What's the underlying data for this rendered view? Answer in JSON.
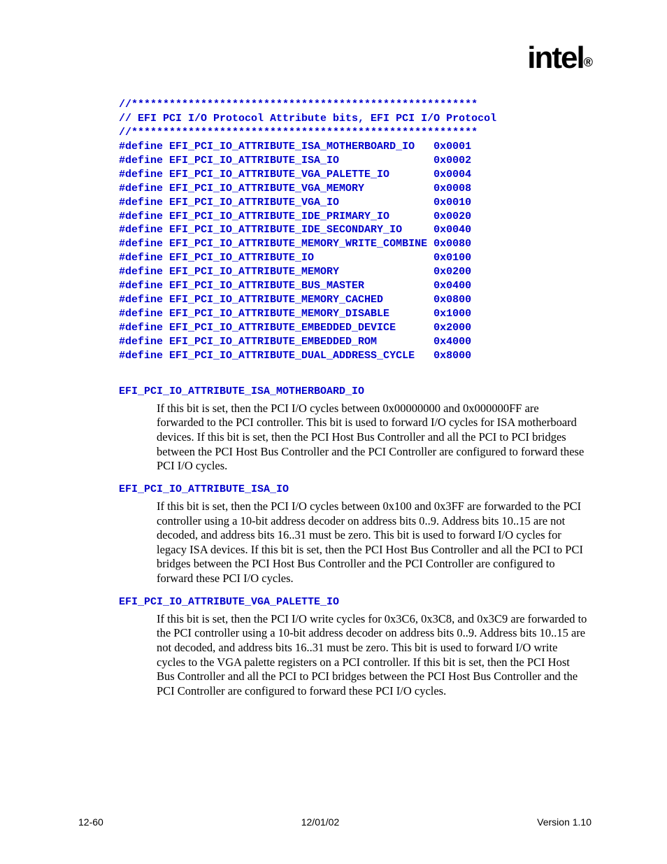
{
  "logo": {
    "text": "intel",
    "r": "®"
  },
  "code": {
    "sep1": "//*******************************************************",
    "comment": "// EFI PCI I/O Protocol Attribute bits, EFI PCI I/O Protocol",
    "sep2": "//*******************************************************",
    "defines": [
      {
        "name": "#define EFI_PCI_IO_ATTRIBUTE_ISA_MOTHERBOARD_IO",
        "val": "0x0001"
      },
      {
        "name": "#define EFI_PCI_IO_ATTRIBUTE_ISA_IO",
        "val": "0x0002"
      },
      {
        "name": "#define EFI_PCI_IO_ATTRIBUTE_VGA_PALETTE_IO",
        "val": "0x0004"
      },
      {
        "name": "#define EFI_PCI_IO_ATTRIBUTE_VGA_MEMORY",
        "val": "0x0008"
      },
      {
        "name": "#define EFI_PCI_IO_ATTRIBUTE_VGA_IO",
        "val": "0x0010"
      },
      {
        "name": "#define EFI_PCI_IO_ATTRIBUTE_IDE_PRIMARY_IO",
        "val": "0x0020"
      },
      {
        "name": "#define EFI_PCI_IO_ATTRIBUTE_IDE_SECONDARY_IO",
        "val": "0x0040"
      },
      {
        "name": "#define EFI_PCI_IO_ATTRIBUTE_MEMORY_WRITE_COMBINE",
        "val": "0x0080"
      },
      {
        "name": "#define EFI_PCI_IO_ATTRIBUTE_IO",
        "val": "0x0100"
      },
      {
        "name": "#define EFI_PCI_IO_ATTRIBUTE_MEMORY",
        "val": "0x0200"
      },
      {
        "name": "#define EFI_PCI_IO_ATTRIBUTE_BUS_MASTER",
        "val": "0x0400"
      },
      {
        "name": "#define EFI_PCI_IO_ATTRIBUTE_MEMORY_CACHED",
        "val": "0x0800"
      },
      {
        "name": "#define EFI_PCI_IO_ATTRIBUTE_MEMORY_DISABLE",
        "val": "0x1000"
      },
      {
        "name": "#define EFI_PCI_IO_ATTRIBUTE_EMBEDDED_DEVICE",
        "val": "0x2000"
      },
      {
        "name": "#define EFI_PCI_IO_ATTRIBUTE_EMBEDDED_ROM",
        "val": "0x4000"
      },
      {
        "name": "#define EFI_PCI_IO_ATTRIBUTE_DUAL_ADDRESS_CYCLE",
        "val": "0x8000"
      }
    ]
  },
  "descriptions": [
    {
      "term": "EFI_PCI_IO_ATTRIBUTE_ISA_MOTHERBOARD_IO",
      "text": "If this bit is set, then the PCI I/O cycles between 0x00000000 and 0x000000FF are forwarded to the PCI controller.  This bit is used to forward I/O cycles for ISA motherboard devices.  If this bit is set, then the PCI Host Bus Controller and all the PCI to PCI bridges between the PCI Host Bus Controller and the PCI Controller are configured to forward these PCI I/O cycles."
    },
    {
      "term": "EFI_PCI_IO_ATTRIBUTE_ISA_IO",
      "text": "If this bit is set, then the PCI I/O cycles between 0x100 and 0x3FF are forwarded to the PCI controller using a 10-bit address decoder on address bits 0..9.  Address bits 10..15 are not decoded, and address bits 16..31 must be zero.  This bit is used to forward I/O cycles for legacy ISA devices.  If this bit is set, then the PCI Host Bus Controller and all the PCI to PCI bridges between the PCI Host Bus Controller and the PCI Controller are configured to forward these PCI I/O cycles."
    },
    {
      "term": "EFI_PCI_IO_ATTRIBUTE_VGA_PALETTE_IO",
      "text": "If this bit is set, then the PCI I/O write cycles for 0x3C6, 0x3C8, and 0x3C9 are forwarded to the PCI controller using a 10-bit address decoder on address bits 0..9.  Address bits 10..15 are not decoded, and address bits 16..31 must be zero.  This bit is used to forward I/O write cycles to the VGA palette registers on a PCI controller.  If this bit is set, then the PCI Host Bus Controller and all the PCI to PCI bridges between the PCI Host Bus Controller and the PCI Controller are configured to forward these PCI I/O cycles."
    }
  ],
  "footer": {
    "left": "12-60",
    "center": "12/01/02",
    "right": "Version 1.10"
  }
}
